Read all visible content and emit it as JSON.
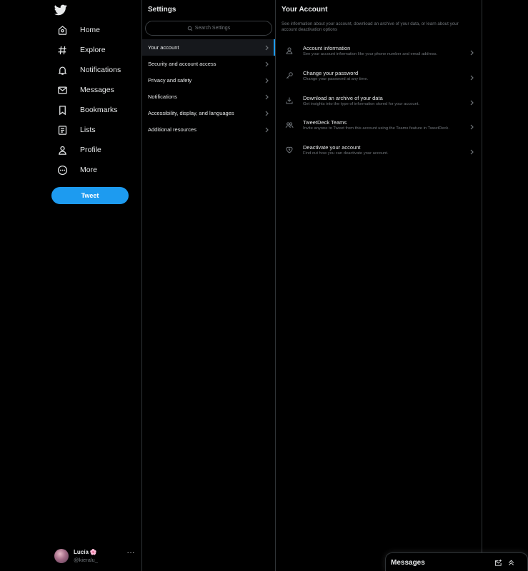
{
  "nav": {
    "logo_icon": "twitter-bird-icon",
    "items": [
      {
        "label": "Home",
        "icon": "home-icon"
      },
      {
        "label": "Explore",
        "icon": "hashtag-icon"
      },
      {
        "label": "Notifications",
        "icon": "bell-icon"
      },
      {
        "label": "Messages",
        "icon": "envelope-icon"
      },
      {
        "label": "Bookmarks",
        "icon": "bookmark-icon"
      },
      {
        "label": "Lists",
        "icon": "list-icon"
      },
      {
        "label": "Profile",
        "icon": "person-icon"
      },
      {
        "label": "More",
        "icon": "more-circle-icon"
      }
    ],
    "tweet_label": "Tweet"
  },
  "user": {
    "name": "Lucía",
    "emoji": "🌸",
    "handle": "@kieralu_"
  },
  "settings": {
    "title": "Settings",
    "search_placeholder": "Search Settings",
    "items": [
      {
        "label": "Your account",
        "active": true
      },
      {
        "label": "Security and account access"
      },
      {
        "label": "Privacy and safety"
      },
      {
        "label": "Notifications"
      },
      {
        "label": "Accessibility, display, and languages"
      },
      {
        "label": "Additional resources"
      }
    ]
  },
  "your_account": {
    "title": "Your Account",
    "description": "See information about your account, download an archive of your data, or learn about your account deactivation options",
    "items": [
      {
        "title": "Account information",
        "subtitle": "See your account information like your phone number and email address.",
        "icon": "person-icon"
      },
      {
        "title": "Change your password",
        "subtitle": "Change your password at any time.",
        "icon": "key-icon"
      },
      {
        "title": "Download an archive of your data",
        "subtitle": "Get insights into the type of information stored for your account.",
        "icon": "download-icon"
      },
      {
        "title": "TweetDeck Teams",
        "subtitle": "Invite anyone to Tweet from this account using the Teams feature in TweetDeck.",
        "icon": "people-icon"
      },
      {
        "title": "Deactivate your account",
        "subtitle": "Find out how you can deactivate your account.",
        "icon": "heart-broken-icon"
      }
    ]
  },
  "messages_drawer": {
    "title": "Messages",
    "compose_icon": "new-message-icon",
    "expand_icon": "double-chevron-up-icon"
  },
  "colors": {
    "background": "#000000",
    "accent": "#1d9bf0",
    "text_primary": "#e7e9ea",
    "text_secondary": "#71767b",
    "divider": "#2f3336"
  }
}
